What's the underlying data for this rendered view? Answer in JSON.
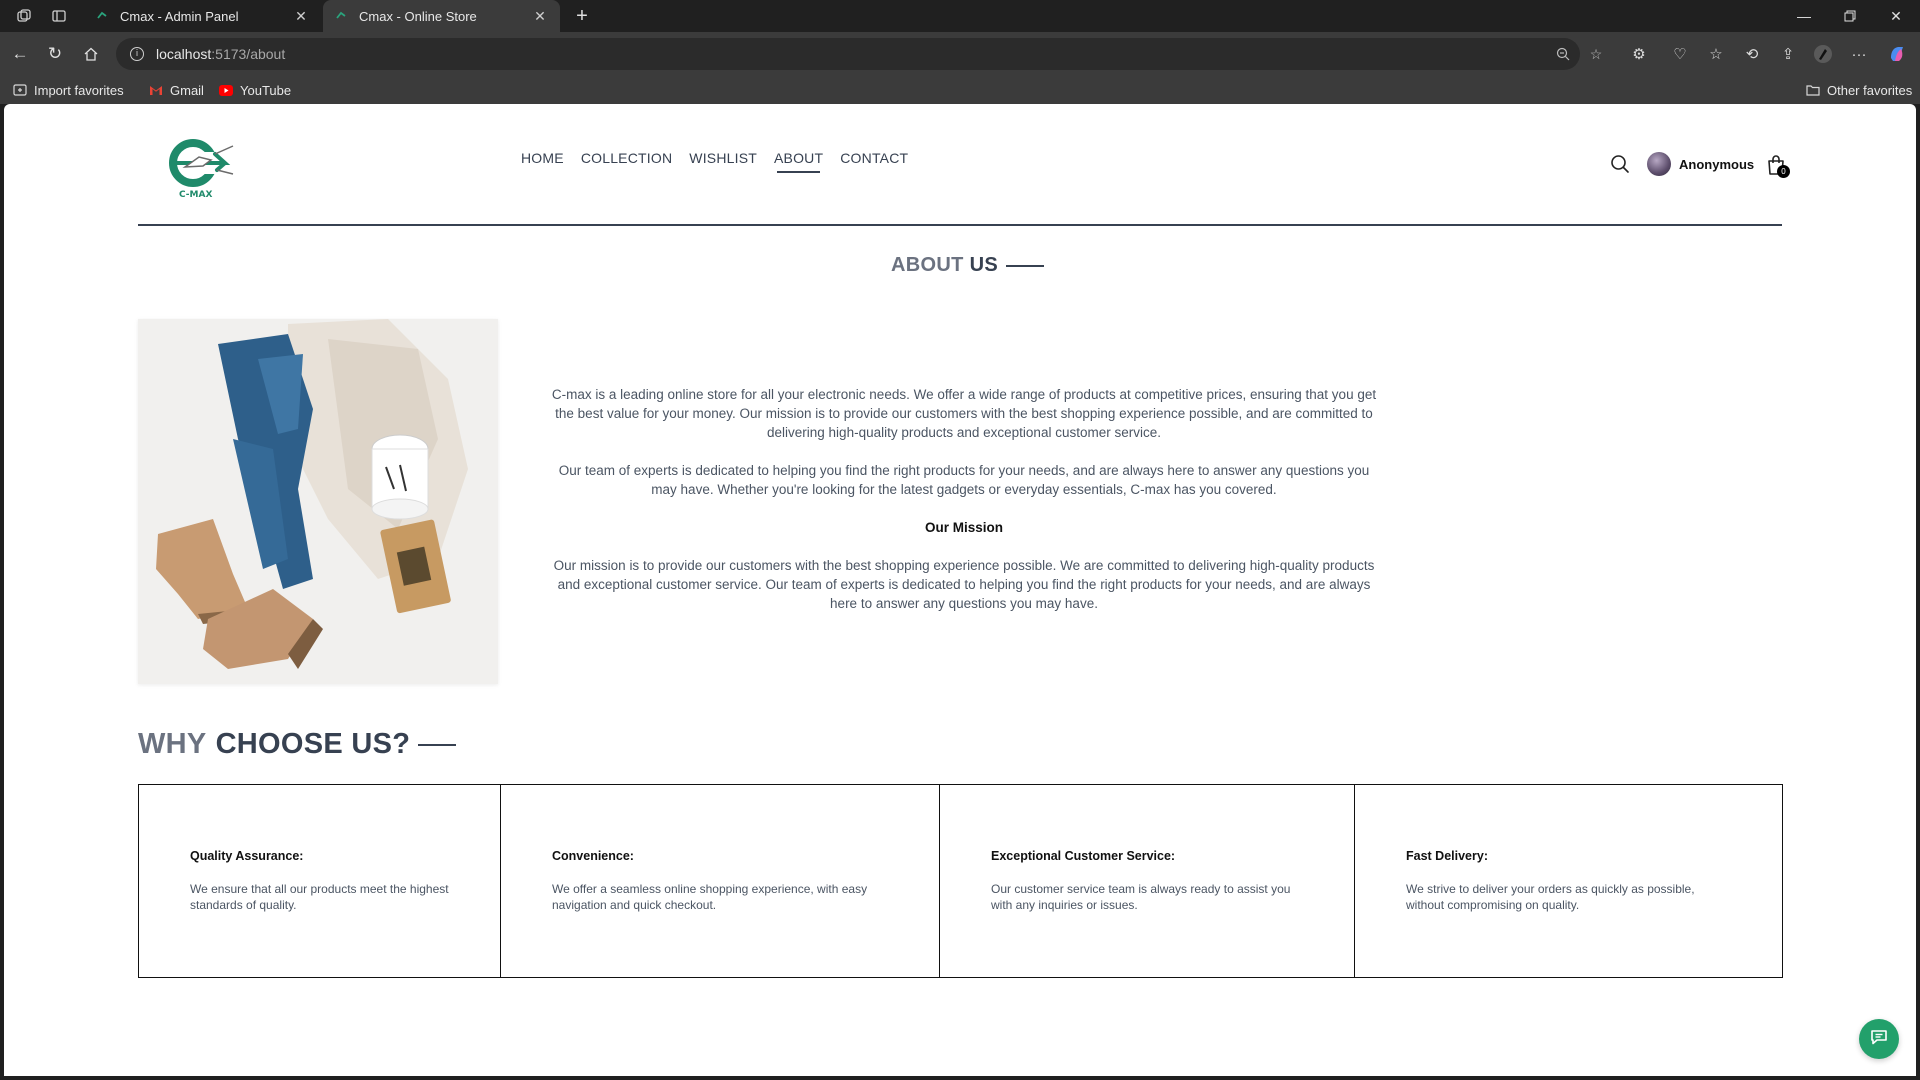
{
  "browser": {
    "tabs": [
      {
        "title": "Cmax - Admin Panel",
        "active": false
      },
      {
        "title": "Cmax - Online Store",
        "active": true
      }
    ],
    "url_host": "localhost",
    "url_path": ":5173/about",
    "bookmarks": [
      {
        "label": "Import favorites",
        "icon": "import-icon"
      },
      {
        "label": "Gmail",
        "icon": "gmail-icon"
      },
      {
        "label": "YouTube",
        "icon": "youtube-icon"
      }
    ],
    "other_favorites": "Other favorites"
  },
  "site": {
    "logo_text": "C-MAX",
    "nav": [
      {
        "label": "HOME",
        "active": false
      },
      {
        "label": "COLLECTION",
        "active": false
      },
      {
        "label": "WISHLIST",
        "active": false
      },
      {
        "label": "ABOUT",
        "active": true
      },
      {
        "label": "CONTACT",
        "active": false
      }
    ],
    "user_name": "Anonymous",
    "cart_count": "0"
  },
  "about": {
    "title_light": "ABOUT",
    "title_strong": "US",
    "paragraph1": "C-max is a leading online store for all your electronic needs. We offer a wide range of products at competitive prices, ensuring that you get the best value for your money. Our mission is to provide our customers with the best shopping experience possible, and are committed to delivering high-quality products and exceptional customer service.",
    "paragraph2": "Our team of experts is dedicated to helping you find the right products for your needs, and are always here to answer any questions you may have. Whether you're looking for the latest gadgets or everyday essentials, C-max has you covered.",
    "mission_heading": "Our Mission",
    "mission_text": "Our mission is to provide our customers with the best shopping experience possible. We are committed to delivering high-quality products and exceptional customer service. Our team of experts is dedicated to helping you find the right products for your needs, and are always here to answer any questions you may have."
  },
  "why": {
    "title_light": "WHY",
    "title_strong": "CHOOSE US?",
    "features": [
      {
        "heading": "Quality Assurance:",
        "text": "We ensure that all our products meet the highest standards of quality."
      },
      {
        "heading": "Convenience:",
        "text": "We offer a seamless online shopping experience, with easy navigation and quick checkout."
      },
      {
        "heading": "Exceptional Customer Service:",
        "text": "Our customer service team is always ready to assist you with any inquiries or issues."
      },
      {
        "heading": "Fast Delivery:",
        "text": "We strive to deliver your orders as quickly as possible, without compromising on quality."
      }
    ]
  },
  "colors": {
    "brand_green": "#1f8a6a",
    "text_dark": "#374151",
    "chat_green": "#22a06b"
  }
}
